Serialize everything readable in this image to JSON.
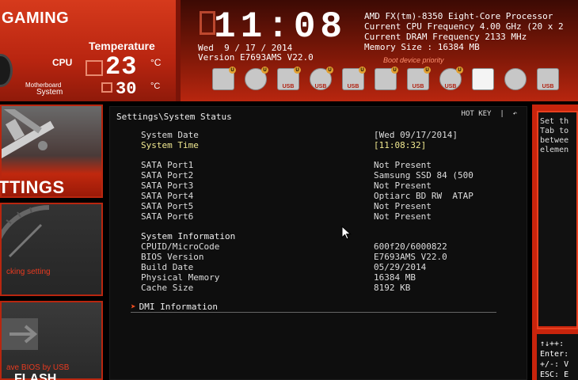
{
  "header": {
    "brand": "GAMING",
    "temperature_title": "Temperature",
    "cpu_label": "CPU",
    "cpu_temp": "23",
    "cpu_unit": "°C",
    "mb_label_line1": "Motherboard",
    "mb_label_line2": "System",
    "mb_temp": "30",
    "mb_unit": "°C",
    "clock": "11:08",
    "date_line": "Wed  9 / 17 / 2014",
    "version_line": "Version E7693AMS V22.0",
    "system_info": [
      "AMD FX(tm)-8350 Eight-Core Processor",
      "Current CPU Frequency 4.00 GHz (20 x 2",
      "Current DRAM Frequency 2133 MHz",
      "Memory Size : 16384 MB"
    ],
    "boot_priority_label": "Boot device priority",
    "boot_devices": [
      {
        "icon": "hdd-icon",
        "text": "",
        "badge": "U"
      },
      {
        "icon": "optical-disc-icon",
        "text": "",
        "badge": "U"
      },
      {
        "icon": "usb-hdd-icon",
        "text": "USB",
        "badge": "U"
      },
      {
        "icon": "usb-optical-icon",
        "text": "USB",
        "badge": "U"
      },
      {
        "icon": "usb-key-icon",
        "text": "USB",
        "badge": "U"
      },
      {
        "icon": "usb-floppy-icon",
        "text": "",
        "badge": "U"
      },
      {
        "icon": "usb-card-icon",
        "text": "USB",
        "badge": "U"
      },
      {
        "icon": "usb-disc-icon",
        "text": "USB",
        "badge": "U"
      },
      {
        "icon": "blank-device-icon",
        "text": "",
        "badge": ""
      },
      {
        "icon": "disc-icon",
        "text": "",
        "badge": ""
      },
      {
        "icon": "usb-drive-icon",
        "text": "USB",
        "badge": ""
      }
    ]
  },
  "left_menu": {
    "settings_label": "TTINGS",
    "oc_label": "cking setting",
    "flash_label": "ave BIOS by USB",
    "flash_big": "FLASH"
  },
  "main": {
    "breadcrumb": "Settings\\System Status",
    "hotkey": "HOT KEY  |  ↶",
    "rows_top": [
      {
        "label": "System Date",
        "value": "[Wed 09/17/2014]",
        "highlight": false
      },
      {
        "label": "System Time",
        "value": "[11:08:32]",
        "highlight": true
      }
    ],
    "sata": [
      {
        "label": "SATA Port1",
        "value": "Not Present"
      },
      {
        "label": "SATA Port2",
        "value": "Samsung SSD 84 (500"
      },
      {
        "label": "SATA Port3",
        "value": "Not Present"
      },
      {
        "label": "SATA Port4",
        "value": "Optiarc BD RW  ATAP"
      },
      {
        "label": "SATA Port5",
        "value": "Not Present"
      },
      {
        "label": "SATA Port6",
        "value": "Not Present"
      }
    ],
    "system_info_title": "System Information",
    "system_info": [
      {
        "label": "CPUID/MicroCode",
        "value": "600f20/6000822"
      },
      {
        "label": "BIOS Version",
        "value": "E7693AMS V22.0"
      },
      {
        "label": "Build Date",
        "value": "05/29/2014"
      },
      {
        "label": "Physical Memory",
        "value": "16384 MB"
      },
      {
        "label": "Cache Size",
        "value": "8192 KB"
      }
    ],
    "dmi_arrow": "➤",
    "dmi_label": "DMI Information"
  },
  "help": {
    "text": "Set th\nTab to\nbetwee\nelemen",
    "keys": "↑↓++:\nEnter:\n+/-: V\nESC: E"
  }
}
